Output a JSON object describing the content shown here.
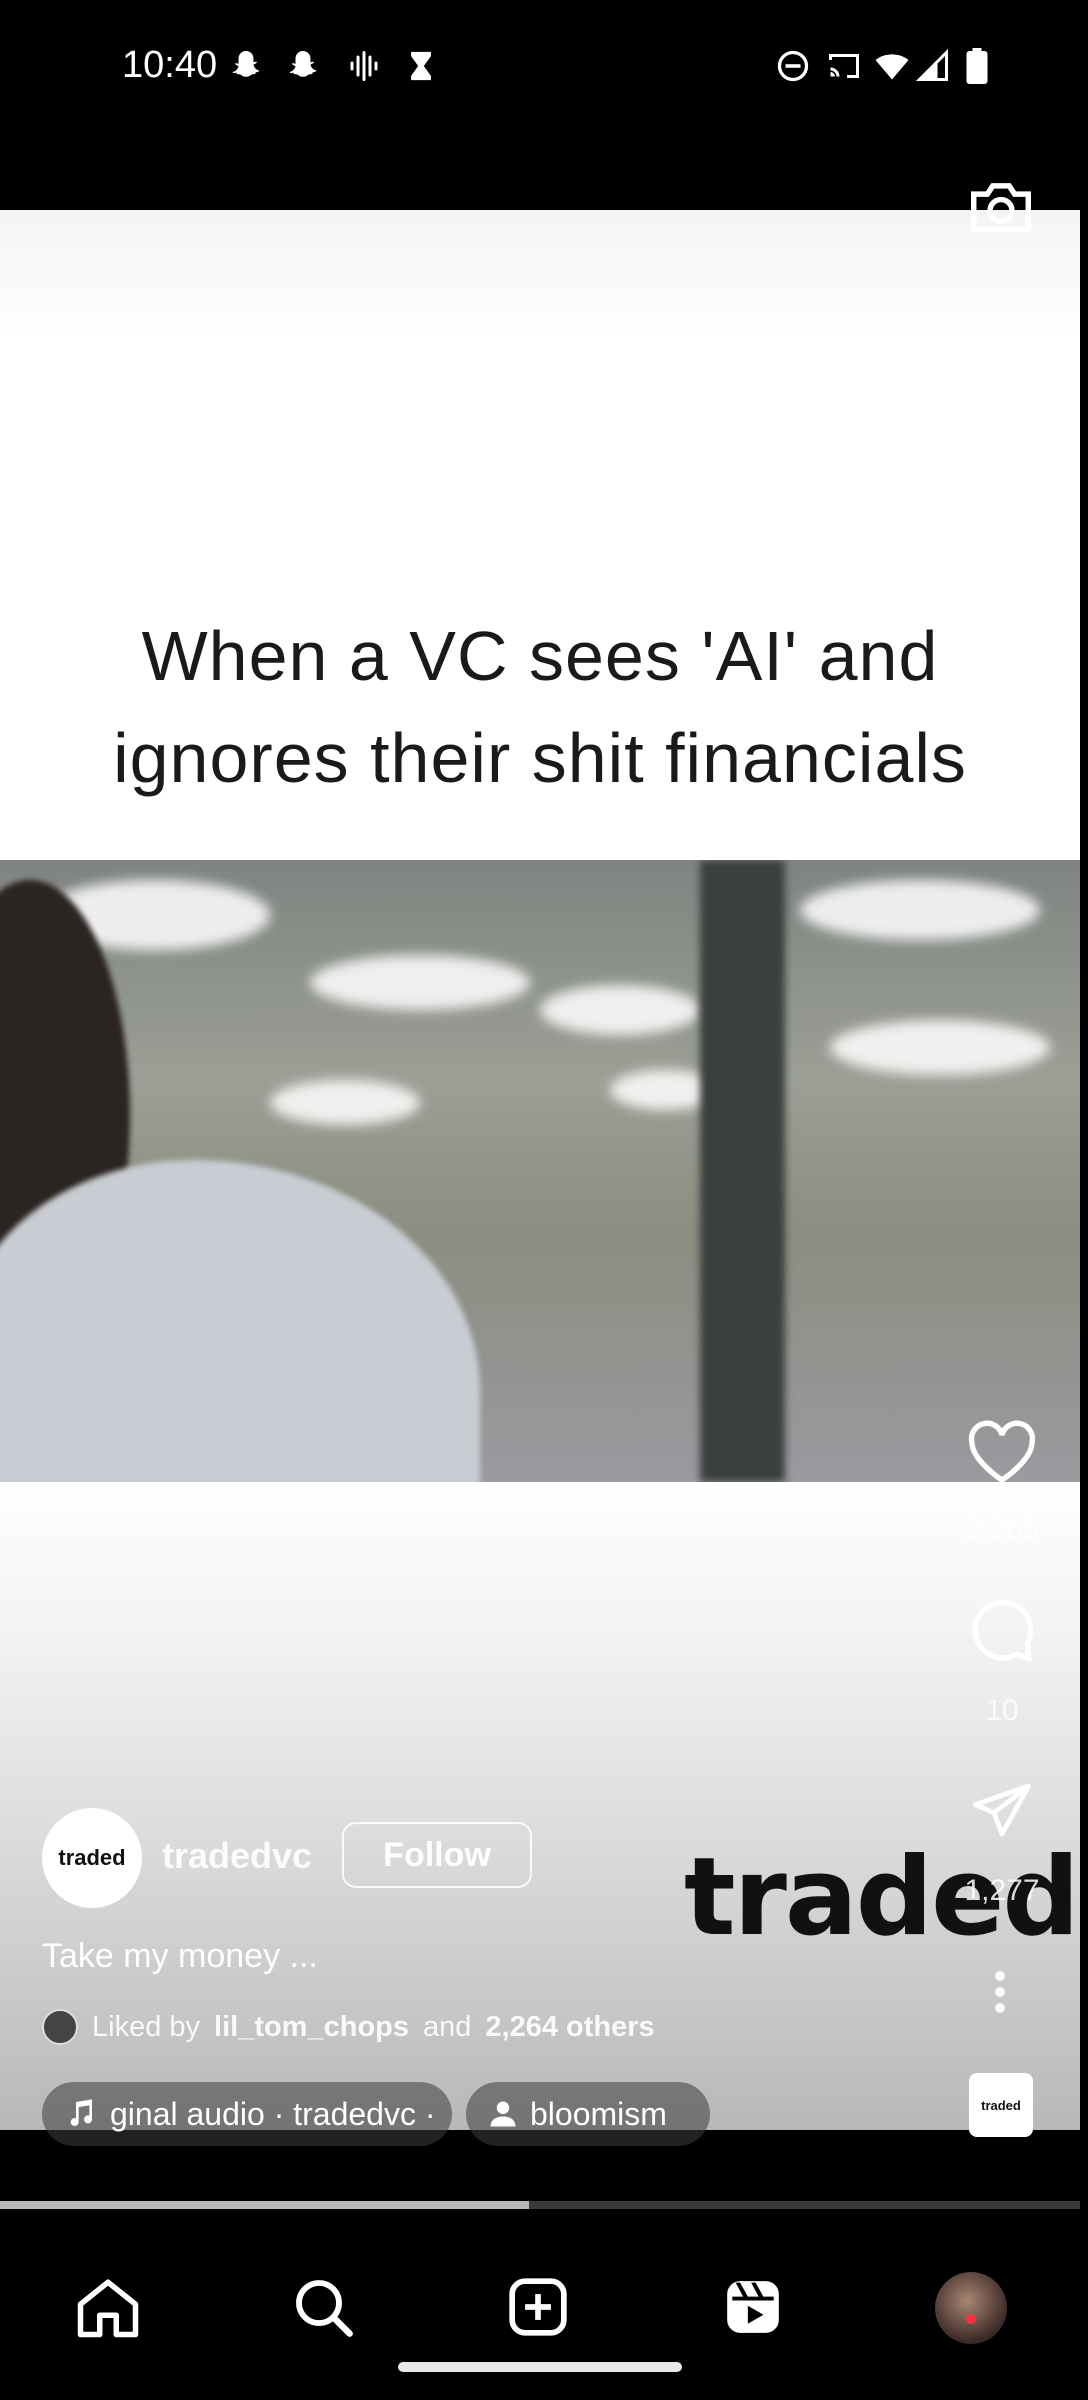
{
  "status_bar": {
    "time": "10:40"
  },
  "post": {
    "meme_caption_line1": "When a VC sees 'AI' and",
    "meme_caption_line2": "ignores their shit financials",
    "watermark": "traded",
    "username": "tradedvc",
    "avatar_text": "traded",
    "follow_label": "Follow",
    "description": "Take my money ...",
    "liked_prefix": "Liked by",
    "liked_user": "lil_tom_chops",
    "liked_and": "and",
    "liked_count": "2,264 others",
    "audio_label": "ginal audio · tradedvc ·",
    "tagged_user": "bloomism",
    "audio_thumb_text": "traded"
  },
  "actions": {
    "likes": "2,265",
    "comments": "10",
    "shares": "1,277"
  },
  "playback": {
    "progress_fraction": 0.49
  },
  "nav": {
    "items": [
      "home",
      "search",
      "create",
      "reels",
      "profile"
    ]
  }
}
